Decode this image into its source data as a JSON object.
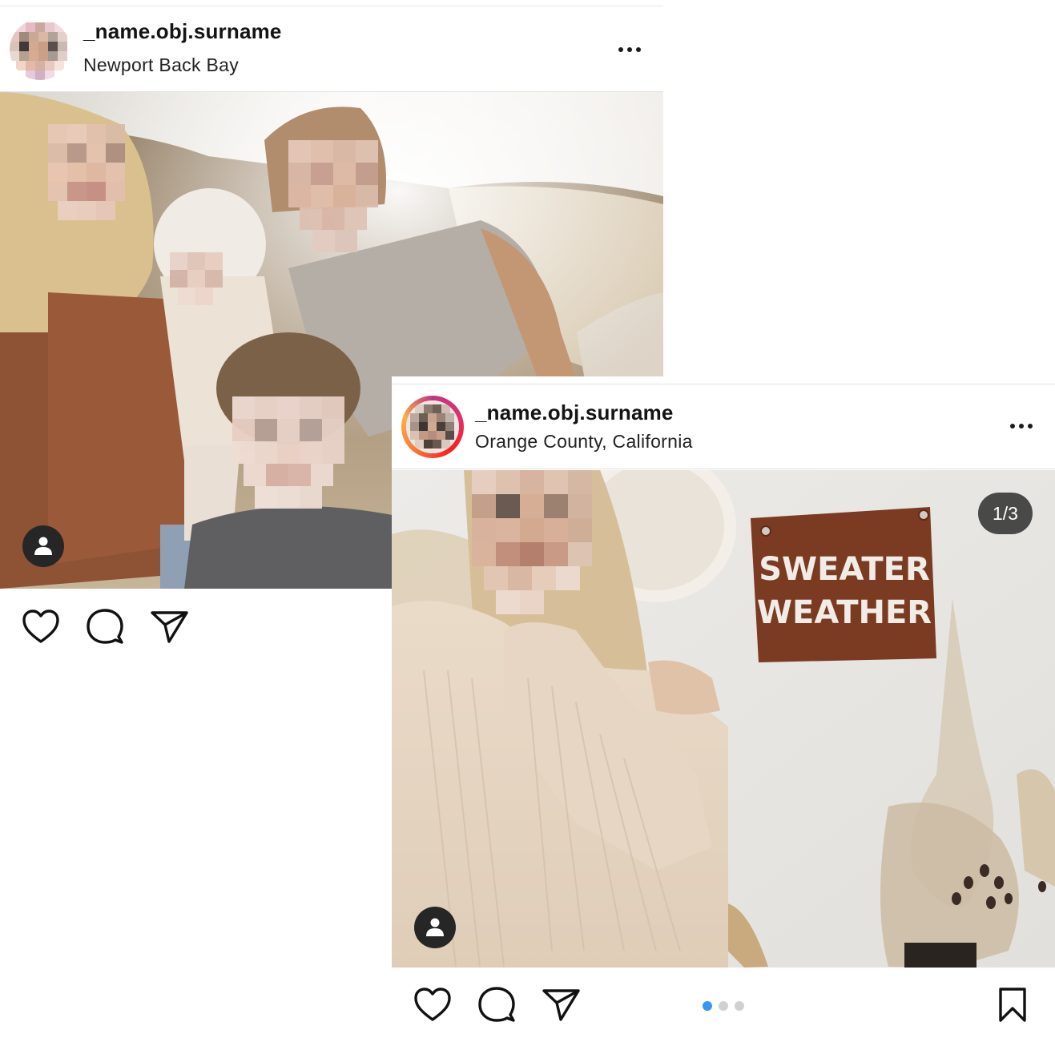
{
  "posts": [
    {
      "username": "_name.obj.surname",
      "location": "Newport Back Bay",
      "has_counter": false
    },
    {
      "username": "_name.obj.surname",
      "location": "Orange County, California",
      "counter": "1/3",
      "banner_line1": "SWEATER",
      "banner_line2": "WEATHER",
      "carousel": {
        "total": 3,
        "active": 1
      }
    }
  ],
  "colors": {
    "accent_dot": "#3897f0",
    "tag_button": "#262626",
    "banner": "#7b3a22"
  },
  "icons": [
    "more-icon",
    "user-tag-icon",
    "heart-icon",
    "comment-icon",
    "share-icon",
    "bookmark-icon"
  ]
}
